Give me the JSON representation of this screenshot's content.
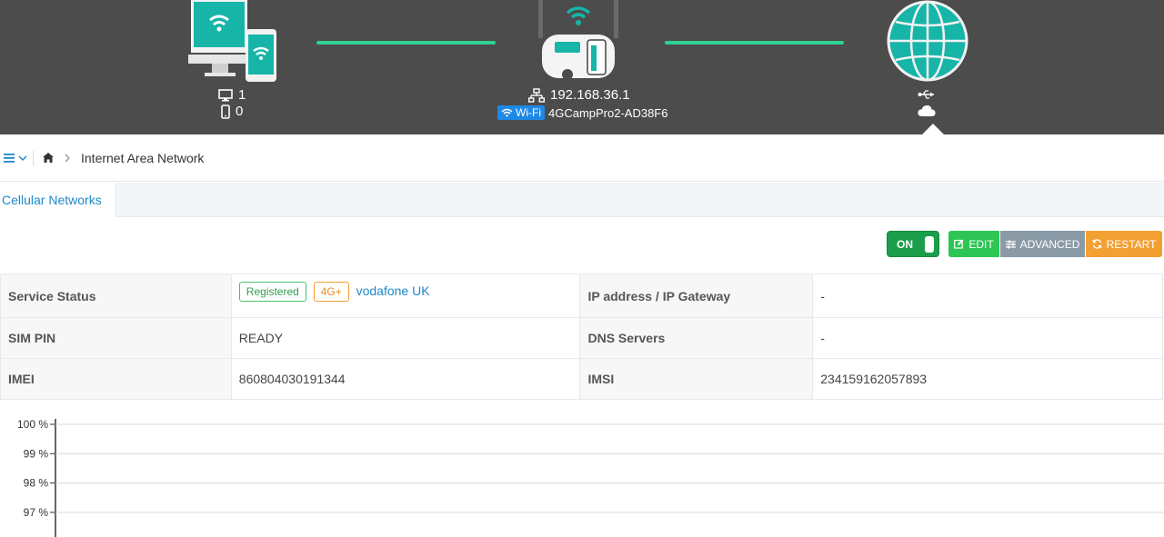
{
  "header": {
    "clients": {
      "desktop_count": "1",
      "mobile_count": "0",
      "desktop_icon": "monitor-icon",
      "mobile_icon": "phone-icon"
    },
    "router": {
      "ip": "192.168.36.1",
      "wifi_badge": "Wi-Fi",
      "ssid": "4GCampPro2-AD38F6",
      "network_icon": "lan-icon"
    },
    "internet": {
      "globe_icon": "globe-icon",
      "usb_icon": "usb-icon",
      "cloud_icon": "cloud-icon"
    },
    "colors": {
      "banner": "#4c4c4c",
      "accent": "#2fd28f",
      "teal": "#17b5a8"
    }
  },
  "breadcrumb": {
    "menu_icon": "hamburger-icon",
    "home_icon": "home-icon",
    "current": "Internet Area Network"
  },
  "tabs": [
    {
      "label": "Cellular Networks",
      "active": true
    }
  ],
  "controls": {
    "toggle_label": "ON",
    "edit_label": "EDIT",
    "advanced_label": "ADVANCED",
    "restart_label": "RESTART"
  },
  "info": {
    "service_status_label": "Service Status",
    "registered_tag": "Registered",
    "network_type_tag": "4G+",
    "operator": "vodafone UK",
    "ip_label": "IP address / IP Gateway",
    "ip_value": "-",
    "sim_pin_label": "SIM PIN",
    "sim_pin_value": "READY",
    "dns_label": "DNS Servers",
    "dns_value": "-",
    "imei_label": "IMEI",
    "imei_value": "860804030191344",
    "imsi_label": "IMSI",
    "imsi_value": "234159162057893"
  },
  "chart_data": {
    "type": "line",
    "ytick_labels": [
      "100 %",
      "99 %",
      "98 %",
      "97 %"
    ],
    "ytick_values": [
      100,
      99,
      98,
      97
    ],
    "ylim": [
      96,
      100
    ],
    "grid": true,
    "series": []
  }
}
